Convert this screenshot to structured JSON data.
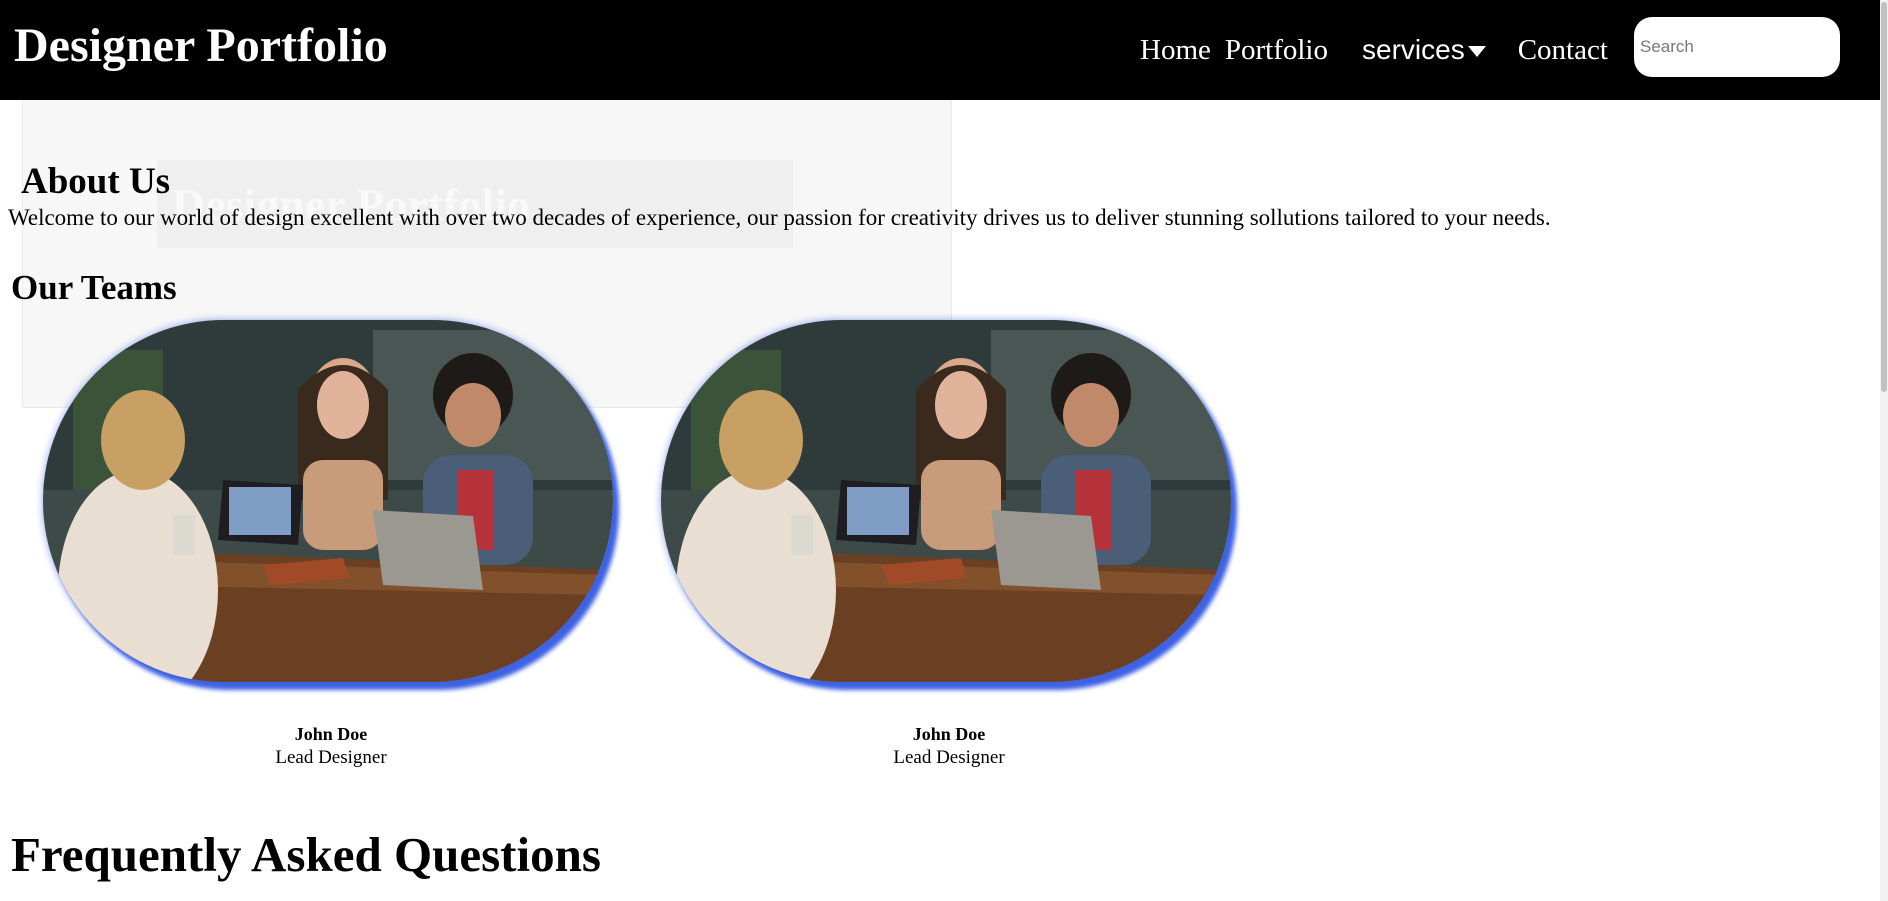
{
  "header": {
    "brand": "Designer Portfolio",
    "nav": {
      "home": "Home",
      "portfolio": "Portfolio",
      "services": "services",
      "contact": "Contact"
    },
    "search": {
      "placeholder": "Search",
      "value": ""
    }
  },
  "ghost": {
    "title": "Designer Portfolio"
  },
  "about": {
    "title": "About Us",
    "text": "Welcome to our world of design excellent with over two decades of experience, our passion for creativity drives us to deliver stunning sollutions tailored to your needs."
  },
  "teams": {
    "title": "Our Teams",
    "members": [
      {
        "name": "John Doe",
        "role": "Lead Designer"
      },
      {
        "name": "John Doe",
        "role": "Lead Designer"
      }
    ]
  },
  "faq": {
    "title": "Frequently Asked Questions"
  },
  "colors": {
    "navbar": "#000000",
    "photo_glow": "#3e62e4"
  }
}
